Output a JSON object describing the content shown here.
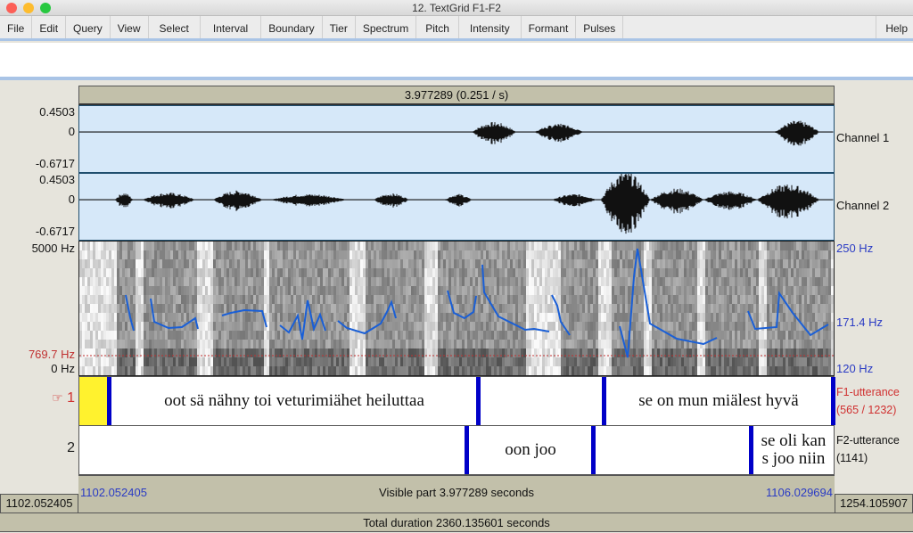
{
  "window": {
    "title": "12. TextGrid F1-F2",
    "traffic_lights": [
      {
        "name": "close",
        "color": "#fc5f57"
      },
      {
        "name": "minimize",
        "color": "#fdbc2e"
      },
      {
        "name": "zoom",
        "color": "#28c840"
      }
    ]
  },
  "menu": {
    "items": [
      "File",
      "Edit",
      "Query",
      "View",
      "Select",
      "Interval",
      "Boundary",
      "Tier",
      "Spectrum",
      "Pitch",
      "Intensity",
      "Formant",
      "Pulses"
    ],
    "help": "Help"
  },
  "text_field": {
    "value": ""
  },
  "selection_bar": {
    "label": "3.977289 (0.251  / s)"
  },
  "channels": [
    {
      "name": "Channel 1",
      "max": "0.4503",
      "zero": "0",
      "min": "-0.6717"
    },
    {
      "name": "Channel 2",
      "max": "0.4503",
      "zero": "0",
      "min": "-0.6717"
    }
  ],
  "spectrogram": {
    "freq_max": "5000 Hz",
    "freq_min": "0 Hz",
    "cursor_freq": "769.7 Hz",
    "pitch_max": "250 Hz",
    "pitch_mid": "171.4 Hz",
    "pitch_min": "120 Hz"
  },
  "colors": {
    "pitch_line": "#1a5fd6",
    "boundary": "#0000c8",
    "cursor_line": "#c03030",
    "selected_interval": "#fff22e",
    "tier_selected_label": "#d03030",
    "time_blue": "#2a3bc4"
  },
  "tiers": [
    {
      "number": "1",
      "pointer_icon": "☞",
      "name": "F1-utterance",
      "count": "(565 / 1232)",
      "intervals": [
        {
          "text": ""
        },
        {
          "text": "oot sä nähny toi veturimiähet heiluttaa"
        },
        {
          "text": ""
        },
        {
          "text": "se on mun miälest hyvä"
        }
      ]
    },
    {
      "number": "2",
      "name": "F2-utterance",
      "count": "(1141)",
      "intervals": [
        {
          "text": ""
        },
        {
          "text": "oon joo"
        },
        {
          "text": ""
        },
        {
          "text": "se oli kan s joo niin"
        }
      ]
    }
  ],
  "time": {
    "window_start": "1102.052405",
    "window_end": "1106.029694",
    "visible_part": "Visible part 3.977289 seconds",
    "left_edge": "1102.052405",
    "right_edge": "1254.105907",
    "total_duration": "Total duration 2360.135601 seconds"
  }
}
